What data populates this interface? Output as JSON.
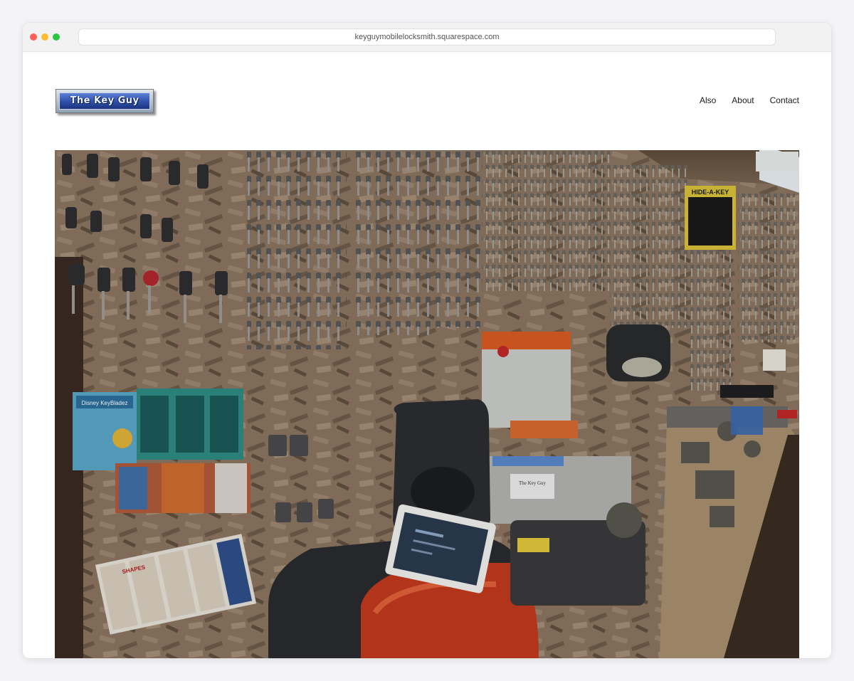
{
  "browser": {
    "url": "keyguymobilelocksmith.squarespace.com"
  },
  "site": {
    "logo_text": "The Key Guy",
    "nav": [
      {
        "label": "Also"
      },
      {
        "label": "About"
      },
      {
        "label": "Contact"
      }
    ]
  },
  "hero": {
    "sign_text": "HIDE-A-KEY",
    "label_text": "The Key Guy",
    "package_brand": "Disney KeyBladez",
    "package_brand_2": "SHAPES"
  }
}
